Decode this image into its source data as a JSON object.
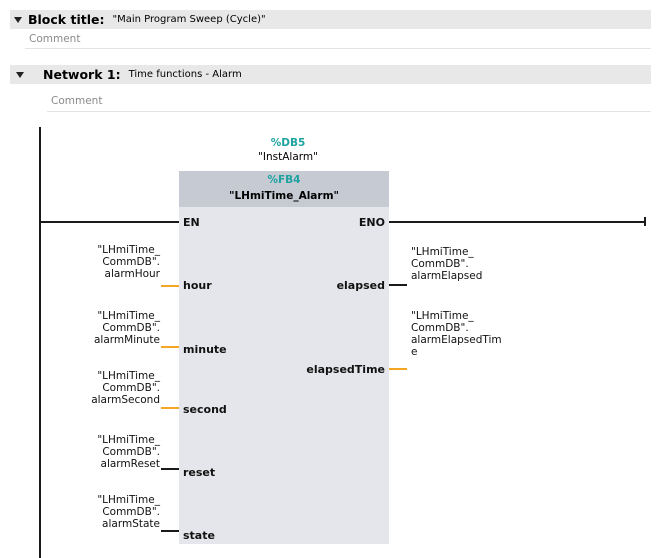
{
  "block_title": {
    "label": "Block title:",
    "value": "\"Main Program Sweep (Cycle)\"",
    "comment": "Comment"
  },
  "network": {
    "label": "Network 1:",
    "title": "Time functions - Alarm",
    "comment": "Comment"
  },
  "instance": {
    "db": "%DB5",
    "name": "\"InstAlarm\""
  },
  "fb": {
    "id": "%FB4",
    "name": "\"LHmiTime_Alarm\""
  },
  "pins": {
    "en": "EN",
    "eno": "ENO"
  },
  "inputs": [
    {
      "pin": "hour",
      "l1": "\"LHmiTime_",
      "l2": "CommDB\".",
      "l3": "alarmHour"
    },
    {
      "pin": "minute",
      "l1": "\"LHmiTime_",
      "l2": "CommDB\".",
      "l3": "alarmMinute"
    },
    {
      "pin": "second",
      "l1": "\"LHmiTime_",
      "l2": "CommDB\".",
      "l3": "alarmSecond"
    },
    {
      "pin": "reset",
      "l1": "\"LHmiTime_",
      "l2": "CommDB\".",
      "l3": "alarmReset"
    },
    {
      "pin": "state",
      "l1": "\"LHmiTime_",
      "l2": "CommDB\".",
      "l3": "alarmState"
    }
  ],
  "outputs": [
    {
      "pin": "elapsed",
      "l1": "\"LHmiTime_",
      "l2": "CommDB\".",
      "l3": "alarmElapsed",
      "l4": ""
    },
    {
      "pin": "elapsedTime",
      "l1": "\"LHmiTime_",
      "l2": "CommDB\".",
      "l3": "alarmElapsedTim",
      "l4": "e"
    }
  ],
  "colors": {
    "teal": "#1ea3a0",
    "orange": "#f5a623",
    "header_gray": "#e8e8e8",
    "block_body": "#e4e6eb",
    "block_head": "#c6cad3"
  }
}
